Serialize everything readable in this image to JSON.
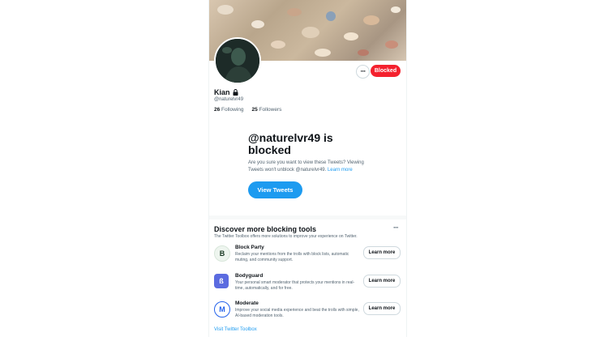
{
  "profile": {
    "name": "Kian",
    "handle": "@naturelvr49",
    "following_count": "26",
    "following_label": "Following",
    "followers_count": "25",
    "followers_label": "Followers",
    "more_label": "···",
    "blocked_label": "Blocked",
    "lock_icon": "lock-icon"
  },
  "blocked_notice": {
    "title": "@naturelvr49 is blocked",
    "text": "Are you sure you want to view these Tweets? Viewing Tweets won't unblock @naturelvr49.",
    "link": "Learn more",
    "button": "View Tweets"
  },
  "discover": {
    "title": "Discover more blocking tools",
    "subtitle": "The Twitter Toolbox offers more solutions to improve your experience on Twitter.",
    "more_label": "···",
    "tools": [
      {
        "name": "Block Party",
        "desc": "Reclaim your mentions from the trolls with block lists, automatic muting, and community support.",
        "button": "Learn more",
        "icon_glyph": "B"
      },
      {
        "name": "Bodyguard",
        "desc": "Your personal smart moderator that protects your mentions in real-time, automatically, and for free.",
        "button": "Learn more",
        "icon_glyph": "ß"
      },
      {
        "name": "Moderate",
        "desc": "Improve your social media experience and beat the trolls with simple, AI-based moderation tools.",
        "button": "Learn more",
        "icon_glyph": "M"
      }
    ],
    "visit_link": "Visit Twitter Toolbox"
  },
  "colors": {
    "accent": "#1d9bf0",
    "blocked": "#f4212e",
    "text": "#0f1419",
    "muted": "#536471"
  }
}
